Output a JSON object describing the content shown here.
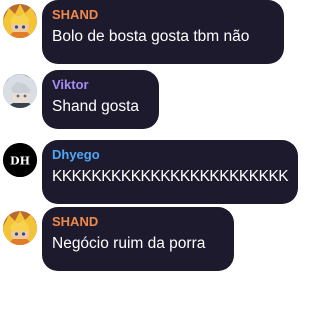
{
  "messages": [
    {
      "name": "SHAND",
      "text": "Bolo de bosta gosta tbm não",
      "name_color": "#f08a4b",
      "avatar": "yellow-hair-anime-avatar"
    },
    {
      "name": "Viktor",
      "text": "Shand gosta",
      "name_color": "#a58cf2",
      "avatar": "silver-hair-anime-avatar"
    },
    {
      "name": "Dhyego",
      "text": "KKKKKKKKKKKKKKKKKKKKKKKK",
      "name_color": "#4fa6f5",
      "avatar": "dh-logo-avatar",
      "avatar_text": "DH"
    },
    {
      "name": "SHAND",
      "text": "Negócio ruim da porra",
      "name_color": "#f08a4b",
      "avatar": "yellow-hair-anime-avatar"
    }
  ]
}
